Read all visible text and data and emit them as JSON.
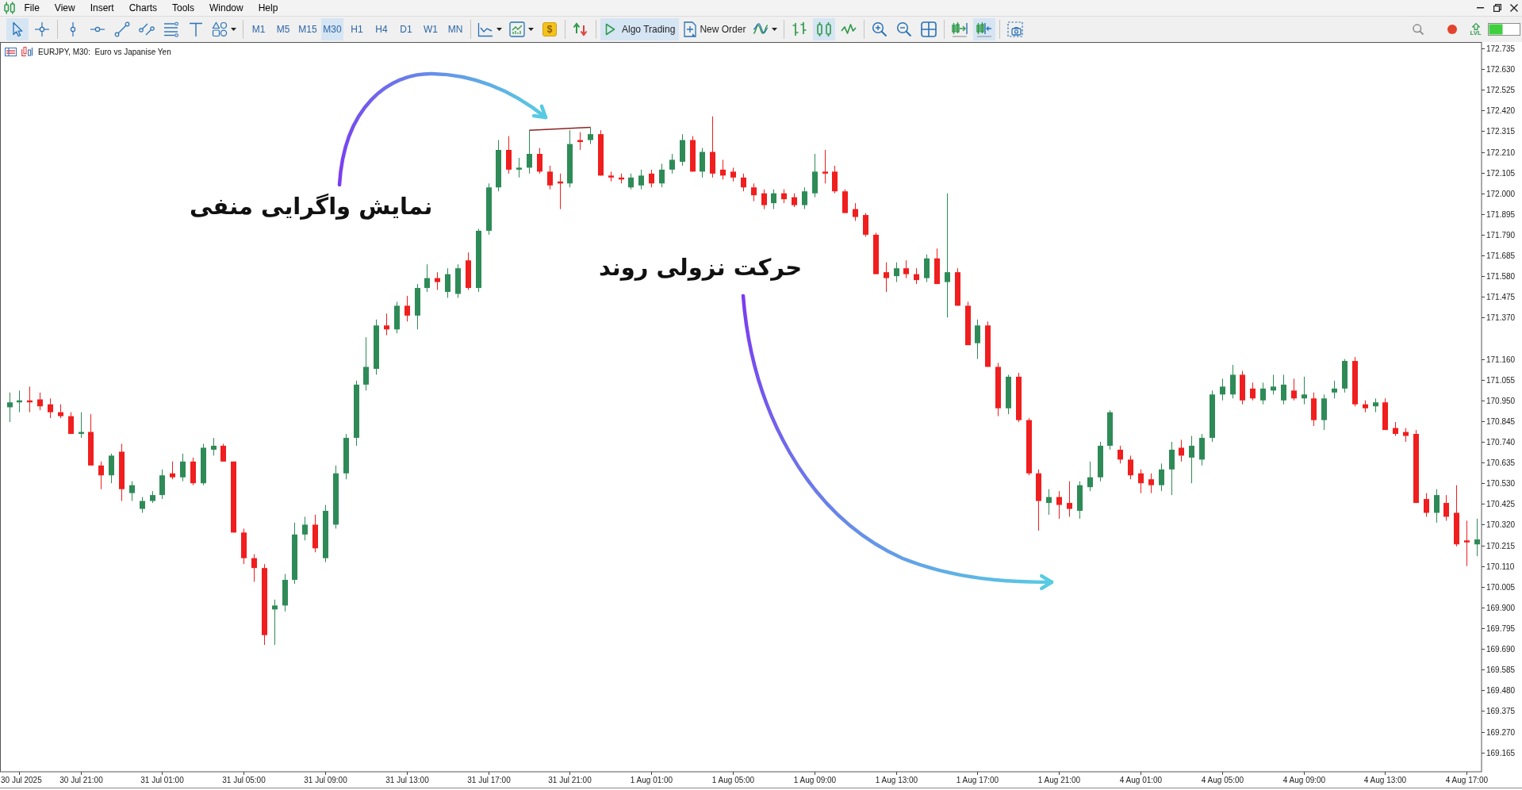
{
  "menu": [
    "File",
    "View",
    "Insert",
    "Charts",
    "Tools",
    "Window",
    "Help"
  ],
  "toolbar": {
    "drawing_tools": [
      {
        "selected": true
      },
      {
        "selected": false
      },
      {
        "selected": false
      },
      {
        "selected": false
      },
      {
        "selected": false
      },
      {
        "selected": false
      },
      {
        "selected": false
      },
      {
        "selected": false
      },
      {
        "selected": false
      }
    ],
    "timeframes": [
      {
        "label": "M1",
        "selected": false
      },
      {
        "label": "M5",
        "selected": false
      },
      {
        "label": "M15",
        "selected": false
      },
      {
        "label": "M30",
        "selected": true
      },
      {
        "label": "H1",
        "selected": false
      },
      {
        "label": "H4",
        "selected": false
      },
      {
        "label": "D1",
        "selected": false
      },
      {
        "label": "W1",
        "selected": false
      },
      {
        "label": "MN",
        "selected": false
      }
    ],
    "market": {
      "label": "$"
    },
    "algo_trading": {
      "label": "Algo Trading",
      "on": true
    },
    "new_order": {
      "label": "New Order"
    },
    "chart_types": [
      {
        "selected": false
      },
      {
        "selected": true
      },
      {
        "selected": false
      }
    ],
    "chart_position": [
      {
        "selected": false
      },
      {
        "selected": true
      }
    ],
    "level_indicator": {
      "label": "LVL"
    }
  },
  "chart": {
    "title": "EURJPY, M30:  Euro vs Japanise Yen",
    "chart_data": [
      {
        "type": "candlestick",
        "ylim": [
          169.067,
          172.763
        ],
        "yticks": [
          172.735,
          {
            "value": 172.63,
            "label": "172.630"
          },
          172.525,
          {
            "value": 172.42,
            "label": "172.420"
          },
          172.315,
          {
            "value": 172.21,
            "label": "172.210"
          },
          172.105,
          {
            "value": 172.0,
            "label": "172.000"
          },
          171.895,
          {
            "value": 171.79,
            "label": "171.790"
          },
          171.685,
          {
            "value": 171.58,
            "label": "171.580"
          },
          171.475,
          {
            "value": 171.37,
            "label": "171.370"
          },
          {
            "value": 171.16,
            "label": "171.160"
          },
          171.055,
          {
            "value": 170.95,
            "label": "170.950"
          },
          170.845,
          {
            "value": 170.74,
            "label": "170.740"
          },
          170.635,
          {
            "value": 170.53,
            "label": "170.530"
          },
          170.425,
          {
            "value": 170.32,
            "label": "170.320"
          },
          170.215,
          {
            "value": 170.11,
            "label": "170.110"
          },
          170.005,
          {
            "value": 169.9,
            "label": "169.900"
          },
          169.795,
          {
            "value": 169.69,
            "label": "169.690"
          },
          169.585,
          {
            "value": 169.48,
            "label": "169.480"
          },
          169.375,
          {
            "value": 169.27,
            "label": "169.270"
          },
          169.165
        ],
        "categories": [
          null,
          "30 Jul 2025",
          null,
          null,
          null,
          null,
          null,
          "30 Jul 21:00",
          null,
          null,
          null,
          null,
          null,
          null,
          null,
          "31 Jul 01:00",
          null,
          null,
          null,
          null,
          null,
          null,
          null,
          "31 Jul 05:00",
          null,
          null,
          null,
          null,
          null,
          null,
          null,
          "31 Jul 09:00",
          null,
          null,
          null,
          null,
          null,
          null,
          null,
          "31 Jul 13:00",
          null,
          null,
          null,
          null,
          null,
          null,
          null,
          "31 Jul 17:00",
          null,
          null,
          null,
          null,
          null,
          null,
          null,
          "31 Jul 21:00",
          null,
          null,
          null,
          null,
          null,
          null,
          null,
          "1 Aug 01:00",
          null,
          null,
          null,
          null,
          null,
          null,
          null,
          "1 Aug 05:00",
          null,
          null,
          null,
          null,
          null,
          null,
          null,
          "1 Aug 09:00",
          null,
          null,
          null,
          null,
          null,
          null,
          null,
          "1 Aug 13:00",
          null,
          null,
          null,
          null,
          null,
          null,
          null,
          "1 Aug 17:00",
          null,
          null,
          null,
          null,
          null,
          null,
          null,
          "1 Aug 21:00",
          null,
          null,
          null,
          null,
          null,
          null,
          null,
          "4 Aug 01:00",
          null,
          null,
          null,
          null,
          null,
          null,
          null,
          "4 Aug 05:00",
          null,
          null,
          null,
          null,
          null,
          null,
          null,
          "4 Aug 09:00",
          null,
          null,
          null,
          null,
          null,
          null,
          null,
          "4 Aug 13:00",
          null,
          null,
          null,
          null,
          null,
          null,
          null,
          "4 Aug 17:00",
          null
        ],
        "ohlc": [
          [
            170.915,
            170.99,
            170.84,
            170.94
          ],
          [
            170.94,
            171.0,
            170.89,
            170.95
          ],
          [
            170.95,
            171.02,
            170.89,
            170.94
          ],
          [
            170.955,
            170.99,
            170.9,
            170.92
          ],
          [
            170.93,
            170.96,
            170.86,
            170.89
          ],
          [
            170.89,
            170.93,
            170.86,
            170.87
          ],
          [
            170.87,
            170.89,
            170.78,
            170.78
          ],
          [
            170.78,
            170.89,
            170.76,
            170.79
          ],
          [
            170.79,
            170.88,
            170.62,
            170.62
          ],
          [
            170.62,
            170.64,
            170.5,
            170.57
          ],
          [
            170.57,
            170.68,
            170.53,
            170.67
          ],
          [
            170.69,
            170.73,
            170.44,
            170.5
          ],
          [
            170.48,
            170.54,
            170.44,
            170.52
          ],
          [
            170.4,
            170.46,
            170.38,
            170.44
          ],
          [
            170.44,
            170.49,
            170.43,
            170.47
          ],
          [
            170.47,
            170.6,
            170.45,
            170.57
          ],
          [
            170.58,
            170.64,
            170.55,
            170.56
          ],
          [
            170.56,
            170.68,
            170.54,
            170.64
          ],
          [
            170.64,
            170.66,
            170.52,
            170.53
          ],
          [
            170.53,
            170.73,
            170.52,
            170.71
          ],
          [
            170.7,
            170.76,
            170.67,
            170.72
          ],
          [
            170.72,
            170.73,
            170.64,
            170.64
          ],
          [
            170.64,
            170.64,
            170.28,
            170.28
          ],
          [
            170.28,
            170.3,
            170.12,
            170.15
          ],
          [
            170.15,
            170.17,
            170.03,
            170.1
          ],
          [
            170.1,
            170.12,
            169.71,
            169.76
          ],
          [
            169.89,
            169.94,
            169.71,
            169.91
          ],
          [
            169.91,
            170.07,
            169.88,
            170.04
          ],
          [
            170.04,
            170.33,
            170.02,
            170.27
          ],
          [
            170.27,
            170.36,
            170.24,
            170.32
          ],
          [
            170.32,
            170.37,
            170.18,
            170.2
          ],
          [
            170.15,
            170.42,
            170.13,
            170.39
          ],
          [
            170.32,
            170.62,
            170.3,
            170.58
          ],
          [
            170.58,
            170.78,
            170.55,
            170.76
          ],
          [
            170.76,
            171.05,
            170.72,
            171.03
          ],
          [
            171.03,
            171.27,
            171.0,
            171.12
          ],
          [
            171.11,
            171.36,
            171.08,
            171.33
          ],
          [
            171.33,
            171.39,
            171.28,
            171.31
          ],
          [
            171.31,
            171.45,
            171.29,
            171.43
          ],
          [
            171.43,
            171.48,
            171.35,
            171.38
          ],
          [
            171.38,
            171.54,
            171.31,
            171.52
          ],
          [
            171.52,
            171.64,
            171.5,
            171.57
          ],
          [
            171.57,
            171.6,
            171.51,
            171.55
          ],
          [
            171.5,
            171.62,
            171.47,
            171.59
          ],
          [
            171.49,
            171.64,
            171.47,
            171.62
          ],
          [
            171.66,
            171.7,
            171.51,
            171.52
          ],
          [
            171.52,
            171.82,
            171.5,
            171.81
          ],
          [
            171.81,
            172.05,
            171.79,
            172.03
          ],
          [
            172.03,
            172.27,
            172.01,
            172.22
          ],
          [
            172.22,
            172.29,
            172.1,
            172.12
          ],
          [
            172.12,
            172.18,
            172.08,
            172.13
          ],
          [
            172.13,
            172.32,
            172.1,
            172.2
          ],
          [
            172.2,
            172.23,
            172.1,
            172.11
          ],
          [
            172.11,
            172.14,
            172.02,
            172.04
          ],
          [
            172.06,
            172.1,
            171.92,
            172.05
          ],
          [
            172.05,
            172.32,
            172.03,
            172.25
          ],
          [
            172.27,
            172.31,
            172.22,
            172.26
          ],
          [
            172.27,
            172.335,
            172.25,
            172.3
          ],
          [
            172.3,
            172.32,
            172.09,
            172.09
          ],
          [
            172.09,
            172.11,
            172.06,
            172.08
          ],
          [
            172.08,
            172.1,
            172.05,
            172.07
          ],
          [
            172.03,
            172.1,
            172.02,
            172.08
          ],
          [
            172.04,
            172.12,
            172.02,
            172.09
          ],
          [
            172.1,
            172.12,
            172.03,
            172.05
          ],
          [
            172.05,
            172.15,
            172.03,
            172.12
          ],
          [
            172.12,
            172.2,
            172.1,
            172.17
          ],
          [
            172.16,
            172.3,
            172.14,
            172.27
          ],
          [
            172.27,
            172.29,
            172.11,
            172.11
          ],
          [
            172.11,
            172.23,
            172.08,
            172.21
          ],
          [
            172.21,
            172.39,
            172.08,
            172.1
          ],
          [
            172.12,
            172.17,
            172.07,
            172.09
          ],
          [
            172.11,
            172.13,
            172.06,
            172.08
          ],
          [
            172.08,
            172.1,
            172.01,
            172.03
          ],
          [
            172.03,
            172.05,
            171.96,
            171.99
          ],
          [
            172.0,
            172.02,
            171.92,
            171.94
          ],
          [
            171.95,
            172.02,
            171.92,
            172.0
          ],
          [
            172.0,
            172.02,
            171.95,
            171.97
          ],
          [
            171.98,
            172.0,
            171.93,
            171.94
          ],
          [
            171.94,
            172.03,
            171.92,
            172.01
          ],
          [
            172.0,
            172.2,
            171.98,
            172.11
          ],
          [
            172.11,
            172.22,
            172.05,
            172.1
          ],
          [
            172.11,
            172.14,
            172.0,
            172.01
          ],
          [
            172.01,
            172.02,
            171.9,
            171.9
          ],
          [
            171.92,
            171.95,
            171.86,
            171.88
          ],
          [
            171.89,
            171.9,
            171.78,
            171.79
          ],
          [
            171.79,
            171.8,
            171.59,
            171.59
          ],
          [
            171.6,
            171.65,
            171.5,
            171.57
          ],
          [
            171.58,
            171.65,
            171.55,
            171.62
          ],
          [
            171.62,
            171.66,
            171.57,
            171.59
          ],
          [
            171.59,
            171.62,
            171.54,
            171.56
          ],
          [
            171.57,
            171.69,
            171.55,
            171.67
          ],
          [
            171.67,
            171.72,
            171.54,
            171.54
          ],
          [
            171.55,
            172.0,
            171.37,
            171.6
          ],
          [
            171.6,
            171.62,
            171.43,
            171.43
          ],
          [
            171.43,
            171.45,
            171.23,
            171.23
          ],
          [
            171.24,
            171.36,
            171.16,
            171.33
          ],
          [
            171.33,
            171.35,
            171.12,
            171.12
          ],
          [
            171.12,
            171.14,
            170.87,
            170.91
          ],
          [
            170.91,
            171.08,
            170.88,
            171.07
          ],
          [
            171.07,
            171.09,
            170.84,
            170.85
          ],
          [
            170.85,
            170.86,
            170.57,
            170.58
          ],
          [
            170.58,
            170.6,
            170.29,
            170.44
          ],
          [
            170.43,
            170.5,
            170.37,
            170.46
          ],
          [
            170.46,
            170.49,
            170.35,
            170.42
          ],
          [
            170.43,
            170.54,
            170.36,
            170.4
          ],
          [
            170.39,
            170.54,
            170.35,
            170.52
          ],
          [
            170.51,
            170.64,
            170.49,
            170.56
          ],
          [
            170.56,
            170.74,
            170.54,
            170.72
          ],
          [
            170.72,
            170.9,
            170.7,
            170.89
          ],
          [
            170.7,
            170.72,
            170.63,
            170.65
          ],
          [
            170.65,
            170.67,
            170.55,
            170.57
          ],
          [
            170.58,
            170.6,
            170.48,
            170.53
          ],
          [
            170.55,
            170.58,
            170.48,
            170.52
          ],
          [
            170.52,
            170.63,
            170.49,
            170.6
          ],
          [
            170.6,
            170.74,
            170.47,
            170.7
          ],
          [
            170.71,
            170.75,
            170.64,
            170.67
          ],
          [
            170.66,
            170.77,
            170.53,
            170.72
          ],
          [
            170.65,
            170.78,
            170.62,
            170.76
          ],
          [
            170.76,
            171.0,
            170.74,
            170.98
          ],
          [
            170.98,
            171.06,
            170.95,
            171.02
          ],
          [
            170.98,
            171.13,
            170.96,
            171.08
          ],
          [
            171.08,
            171.1,
            170.93,
            170.95
          ],
          [
            171.01,
            171.04,
            170.95,
            170.96
          ],
          [
            170.95,
            171.04,
            170.93,
            171.01
          ],
          [
            171.0,
            171.08,
            170.98,
            171.02
          ],
          [
            170.95,
            171.08,
            170.93,
            171.03
          ],
          [
            171.0,
            171.06,
            170.95,
            170.96
          ],
          [
            170.96,
            171.07,
            170.93,
            170.98
          ],
          [
            170.96,
            170.99,
            170.82,
            170.85
          ],
          [
            170.85,
            170.98,
            170.8,
            170.96
          ],
          [
            170.99,
            171.05,
            170.96,
            171.01
          ],
          [
            171.01,
            171.16,
            170.99,
            171.15
          ],
          [
            171.15,
            171.17,
            170.92,
            170.93
          ],
          [
            170.93,
            170.95,
            170.89,
            170.91
          ],
          [
            170.92,
            170.96,
            170.89,
            170.94
          ],
          [
            170.94,
            170.96,
            170.8,
            170.8
          ],
          [
            170.81,
            170.84,
            170.77,
            170.78
          ],
          [
            170.79,
            170.81,
            170.74,
            170.77
          ],
          [
            170.78,
            170.8,
            170.43,
            170.43
          ],
          [
            170.45,
            170.48,
            170.36,
            170.38
          ],
          [
            170.38,
            170.5,
            170.33,
            170.47
          ],
          [
            170.43,
            170.47,
            170.34,
            170.36
          ],
          [
            170.38,
            170.52,
            170.21,
            170.22
          ],
          [
            170.24,
            170.34,
            170.11,
            170.23
          ],
          [
            170.22,
            170.35,
            170.16,
            170.245
          ]
        ],
        "annotations": [
          "نمایش واگرایی منفی",
          "حرکت نزولی روند"
        ]
      }
    ]
  }
}
